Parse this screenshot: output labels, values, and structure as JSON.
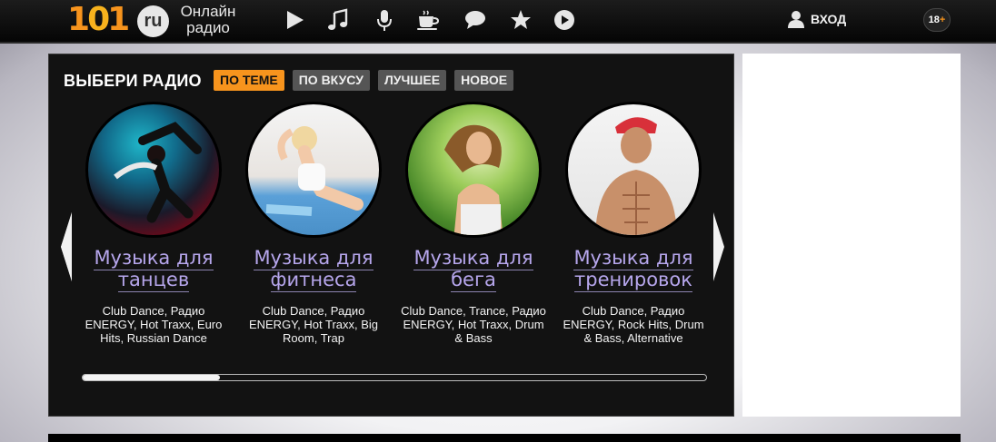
{
  "header": {
    "logo_digits": [
      "1",
      "0",
      "1"
    ],
    "logo_ru": "ru",
    "logo_text_line1": "Онлайн",
    "logo_text_line2": "радио",
    "nav_icons": [
      "play-icon",
      "music-note-icon",
      "microphone-icon",
      "coffee-cup-icon",
      "chat-bubble-icon",
      "star-icon",
      "play-circle-icon"
    ],
    "login_label": "ВХОД",
    "age_label": "18",
    "age_plus": "+"
  },
  "panel": {
    "title": "ВЫБЕРИ РАДИО",
    "tabs": [
      {
        "label": "ПО ТЕМЕ",
        "active": true
      },
      {
        "label": "ПО ВКУСУ",
        "active": false
      },
      {
        "label": "ЛУЧШЕЕ",
        "active": false
      },
      {
        "label": "НОВОЕ",
        "active": false
      }
    ],
    "cards": [
      {
        "title_line1": "Музыка для",
        "title_line2": "танцев",
        "desc": "Club Dance, Радио ENERGY, Hot Traxx, Euro Hits, Russian Dance"
      },
      {
        "title_line1": "Музыка для",
        "title_line2": "фитнеса",
        "desc": "Club Dance, Радио ENERGY, Hot Traxx, Big Room, Trap"
      },
      {
        "title_line1": "Музыка для",
        "title_line2": "бега",
        "desc": "Club Dance, Trance, Радио ENERGY, Hot Traxx, Drum & Bass"
      },
      {
        "title_line1": "Музыка для",
        "title_line2": "тренировок",
        "desc": "Club Dance, Радио ENERGY, Rock Hits, Drum & Bass, Alternative"
      }
    ],
    "scroll_position": 0.22
  },
  "colors": {
    "accent": "#f7941d",
    "card_title": "#b6a6ec",
    "panel_bg": "#121212"
  }
}
